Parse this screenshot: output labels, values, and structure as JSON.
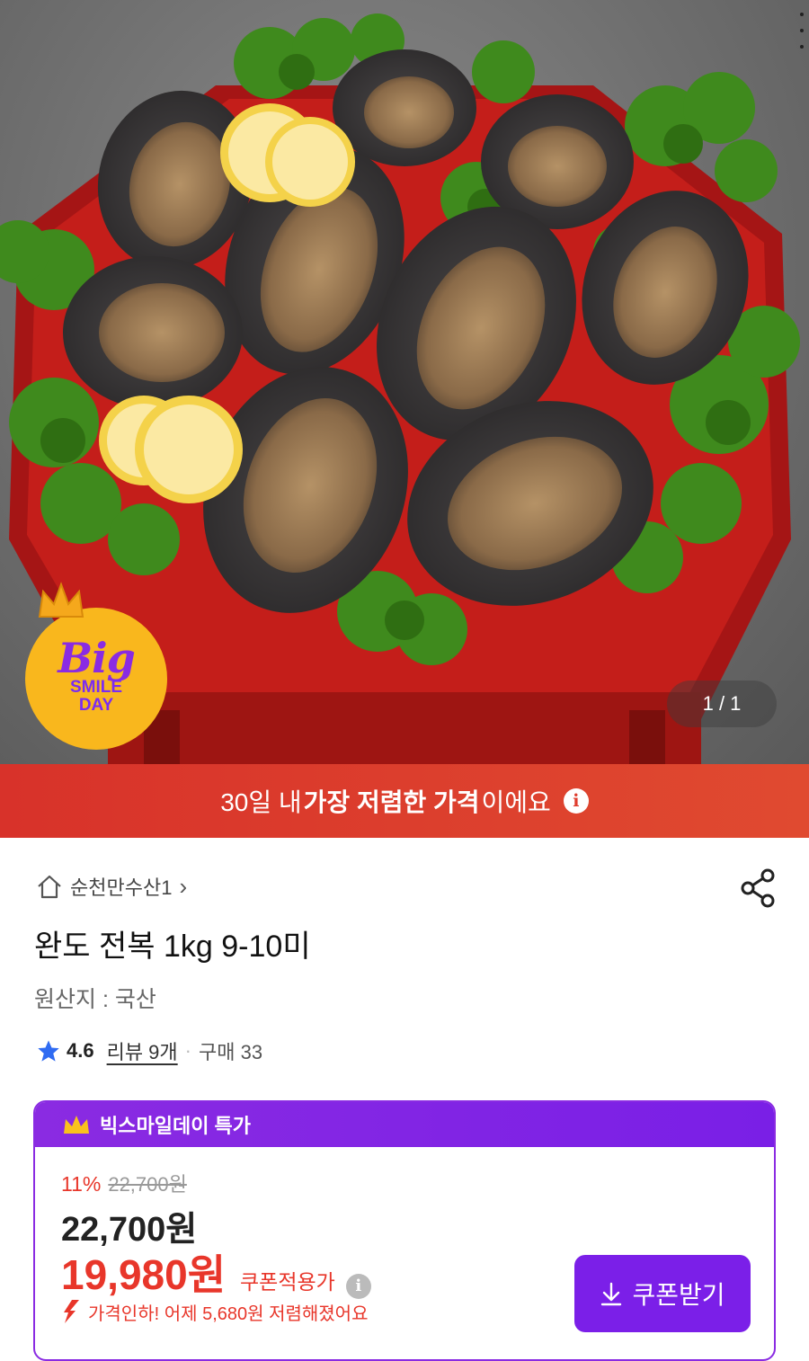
{
  "hero": {
    "pager": "1 / 1",
    "badge": {
      "big": "Big",
      "line1": "SMILE",
      "line2": "DAY"
    }
  },
  "banner": {
    "prefix": "30일 내 ",
    "strong": "가장 저렴한 가격",
    "suffix": "이에요",
    "info": "i"
  },
  "seller": {
    "name": "순천만수산1",
    "arrow": "›"
  },
  "product": {
    "title": "완도 전복 1kg 9-10미",
    "origin": "원산지 : 국산"
  },
  "rating": {
    "score": "4.6",
    "reviews": "리뷰 9개",
    "sep": "·",
    "purchases": "구매 33"
  },
  "promo": {
    "title": "빅스마일데이 특가",
    "discount_pct": "11%",
    "original_price": "22,700원",
    "price": "22,700원",
    "coupon_price": "19,980원",
    "coupon_label": "쿠폰적용가",
    "price_drop": "가격인하! 어제 5,680원 저렴해졌어요",
    "coupon_button": "쿠폰받기"
  },
  "colors": {
    "accent_purple": "#8a2be2",
    "price_red": "#e8362a",
    "banner_red": "#d8322a"
  },
  "icons": [
    "more-vert-icon",
    "crown-icon",
    "info-icon",
    "home-icon",
    "chevron-right-icon",
    "share-icon",
    "star-icon",
    "down-arrow-icon",
    "download-icon"
  ]
}
